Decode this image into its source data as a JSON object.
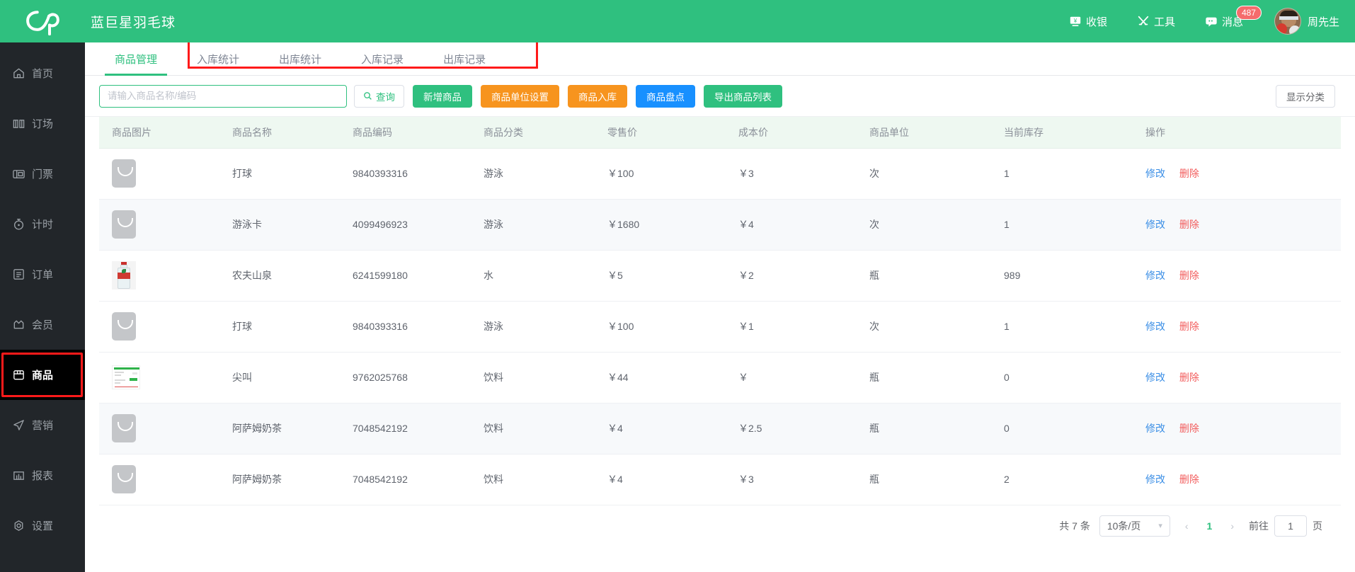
{
  "header": {
    "brand": "蓝巨星羽毛球",
    "logo_icon": "cloud-logo-icon",
    "items": [
      {
        "label": "收银",
        "icon": "cashier-icon"
      },
      {
        "label": "工具",
        "icon": "tools-icon"
      },
      {
        "label": "消息",
        "icon": "message-icon",
        "badge": "487"
      }
    ],
    "user_name": "周先生",
    "avatar_icon": "user-avatar"
  },
  "sidebar": {
    "items": [
      {
        "label": "首页",
        "icon": "home-icon",
        "active": false
      },
      {
        "label": "订场",
        "icon": "booking-icon",
        "active": false
      },
      {
        "label": "门票",
        "icon": "ticket-icon",
        "active": false
      },
      {
        "label": "计时",
        "icon": "timer-icon",
        "active": false
      },
      {
        "label": "订单",
        "icon": "order-icon",
        "active": false
      },
      {
        "label": "会员",
        "icon": "member-icon",
        "active": false
      },
      {
        "label": "商品",
        "icon": "goods-icon",
        "active": true
      },
      {
        "label": "营销",
        "icon": "marketing-icon",
        "active": false
      },
      {
        "label": "报表",
        "icon": "report-icon",
        "active": false
      },
      {
        "label": "设置",
        "icon": "settings-icon",
        "active": false
      }
    ]
  },
  "tabs": [
    {
      "label": "商品管理",
      "active": true
    },
    {
      "label": "入库统计",
      "active": false
    },
    {
      "label": "出库统计",
      "active": false
    },
    {
      "label": "入库记录",
      "active": false
    },
    {
      "label": "出库记录",
      "active": false
    }
  ],
  "toolbar": {
    "search_placeholder": "请输入商品名称/编码",
    "search_value": "",
    "query_label": "查询",
    "query_icon": "search-icon",
    "buttons": [
      {
        "label": "新增商品",
        "color": "#2fc07f"
      },
      {
        "label": "商品单位设置",
        "color": "#f7941e"
      },
      {
        "label": "商品入库",
        "color": "#f7941e"
      },
      {
        "label": "商品盘点",
        "color": "#1890ff"
      },
      {
        "label": "导出商品列表",
        "color": "#2fc07f"
      }
    ],
    "show_category_label": "显示分类"
  },
  "table": {
    "columns": [
      "商品图片",
      "商品名称",
      "商品编码",
      "商品分类",
      "零售价",
      "成本价",
      "商品单位",
      "当前库存",
      "操作"
    ],
    "rows": [
      {
        "image": "placeholder-thumb",
        "name": "打球",
        "code": "9840393316",
        "category": "游泳",
        "price": "￥100",
        "cost": "￥3",
        "unit": "次",
        "stock": "1",
        "edit": "修改",
        "delete": "删除"
      },
      {
        "image": "placeholder-thumb",
        "name": "游泳卡",
        "code": "4099496923",
        "category": "游泳",
        "price": "￥1680",
        "cost": "￥4",
        "unit": "次",
        "stock": "1",
        "edit": "修改",
        "delete": "删除"
      },
      {
        "image": "water-bottle-thumb",
        "name": "农夫山泉",
        "code": "6241599180",
        "category": "水",
        "price": "￥5",
        "cost": "￥2",
        "unit": "瓶",
        "stock": "989",
        "edit": "修改",
        "delete": "删除"
      },
      {
        "image": "placeholder-thumb",
        "name": "打球",
        "code": "9840393316",
        "category": "游泳",
        "price": "￥100",
        "cost": "￥1",
        "unit": "次",
        "stock": "1",
        "edit": "修改",
        "delete": "删除"
      },
      {
        "image": "document-thumb",
        "name": "尖叫",
        "code": "9762025768",
        "category": "饮料",
        "price": "￥44",
        "cost": "￥",
        "unit": "瓶",
        "stock": "0",
        "edit": "修改",
        "delete": "删除"
      },
      {
        "image": "placeholder-thumb",
        "name": "阿萨姆奶茶",
        "code": "7048542192",
        "category": "饮料",
        "price": "￥4",
        "cost": "￥2.5",
        "unit": "瓶",
        "stock": "0",
        "edit": "修改",
        "delete": "删除"
      },
      {
        "image": "placeholder-thumb",
        "name": "阿萨姆奶茶",
        "code": "7048542192",
        "category": "饮料",
        "price": "￥4",
        "cost": "￥3",
        "unit": "瓶",
        "stock": "2",
        "edit": "修改",
        "delete": "删除"
      }
    ]
  },
  "pagination": {
    "total_label": "共 7 条",
    "page_size": "10条/页",
    "prev_icon": "chevron-left-icon",
    "next_icon": "chevron-right-icon",
    "current_page": "1",
    "jump_label": "前往",
    "jump_value": "1",
    "page_unit": "页"
  },
  "colors": {
    "brand_green": "#2fc07f",
    "orange": "#f7941e",
    "blue": "#1890ff",
    "danger_red": "#f25c5c",
    "highlight_red": "#ff1a1a",
    "sidebar_bg": "#22262a"
  }
}
